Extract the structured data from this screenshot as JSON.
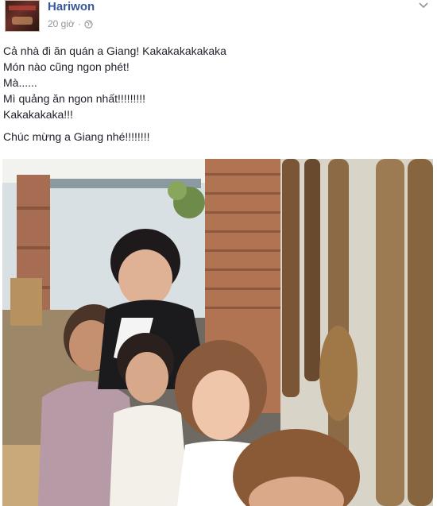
{
  "post": {
    "author": "Hariwon",
    "time": "20 giờ",
    "separator": "·",
    "privacy_icon": "globe-icon",
    "menu_icon": "chevron-down-icon",
    "lines_group1": [
      "Cả nhà đi ăn quán a Giang! Kakakakakakaka",
      "Món nào cũng ngon phét!",
      "Mà......",
      "Mì quảng ăn ngon nhất!!!!!!!!!",
      "Kakakakaka!!!"
    ],
    "lines_group2": [
      "Chúc mừng a Giang nhé!!!!!!!!"
    ]
  },
  "colors": {
    "author": "#365899",
    "meta": "#90949c",
    "text": "#1d2129"
  }
}
